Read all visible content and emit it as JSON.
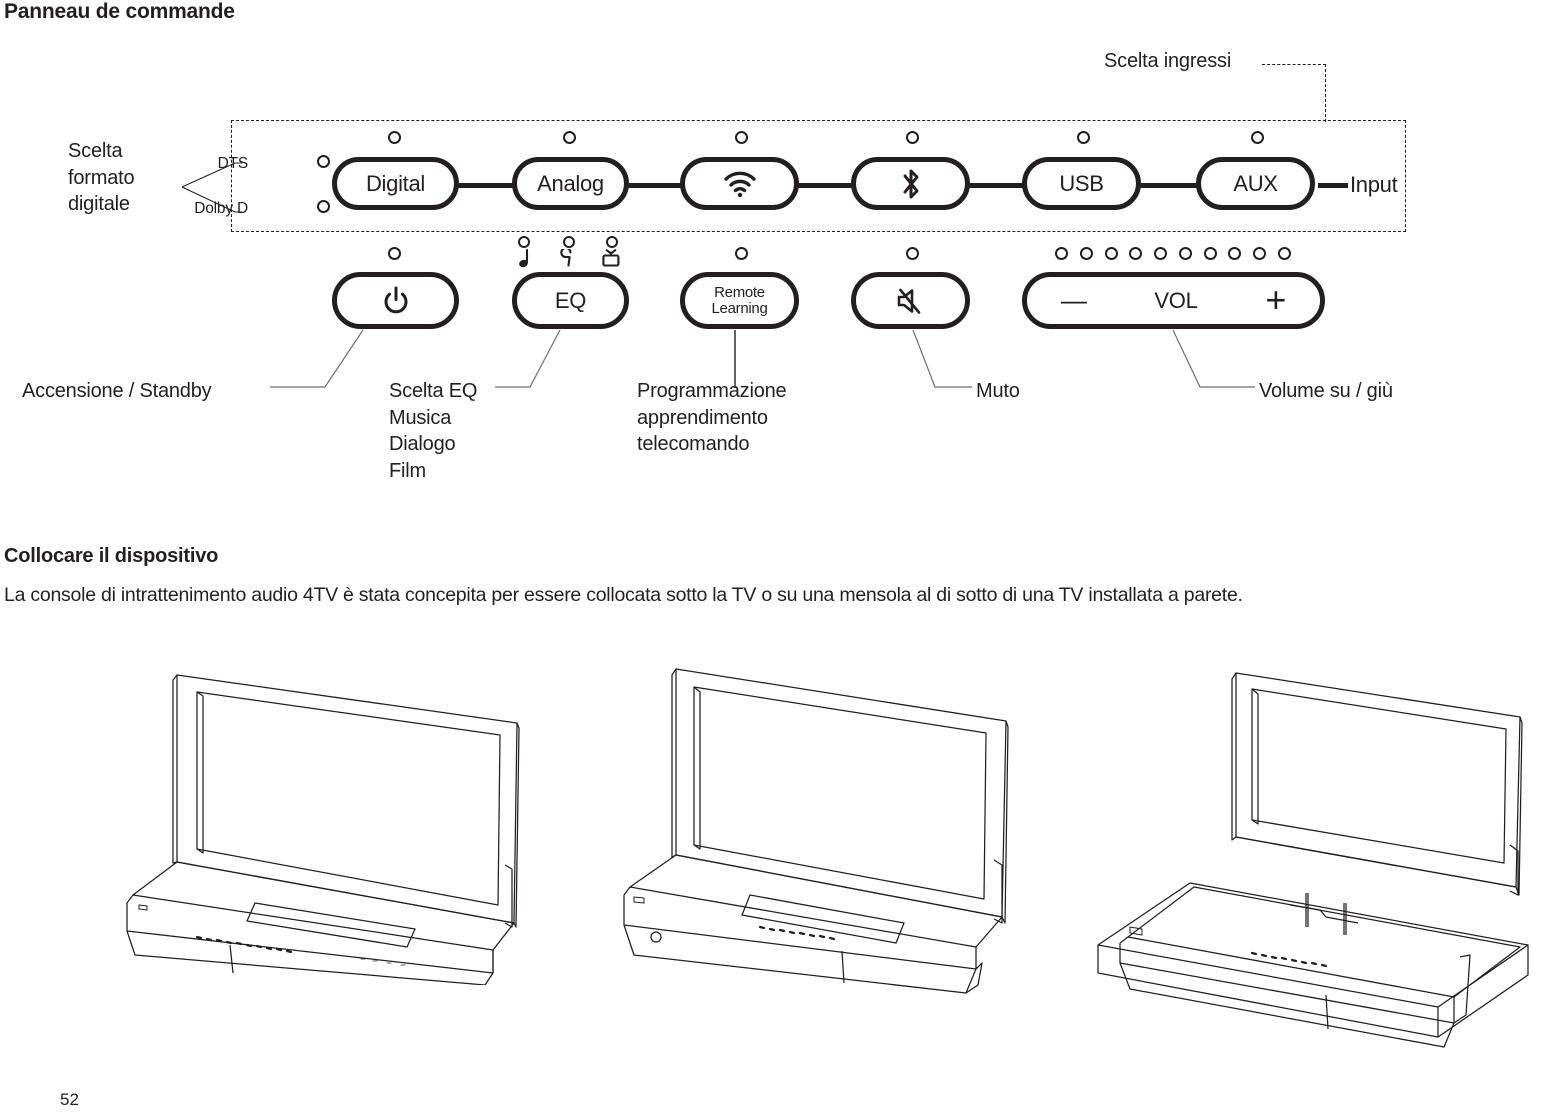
{
  "page": {
    "heading": "Panneau de commande",
    "number": "52"
  },
  "control_panel": {
    "input_group_label": "Scelta ingressi",
    "input_terminal_label": "Input",
    "format_selector": {
      "label": "Scelta\nformato\ndigitale",
      "line1": "Scelta",
      "line2": "formato",
      "line3": "digitale",
      "indicators": [
        {
          "label": "DTS",
          "name": "dts-indicator"
        },
        {
          "label": "Dolby D",
          "name": "dolby-d-indicator"
        }
      ]
    },
    "source_buttons": [
      {
        "label": "Digital",
        "icon": "",
        "name": "digital-button"
      },
      {
        "label": "Analog",
        "icon": "",
        "name": "analog-button"
      },
      {
        "label": "",
        "icon": "wifi-icon",
        "name": "wifi-button"
      },
      {
        "label": "",
        "icon": "bluetooth-icon",
        "name": "bluetooth-button"
      },
      {
        "label": "USB",
        "icon": "",
        "name": "usb-button"
      },
      {
        "label": "AUX",
        "icon": "",
        "name": "aux-button"
      }
    ],
    "function_buttons": [
      {
        "label": "",
        "icon": "power-icon",
        "name": "power-button"
      },
      {
        "label": "EQ",
        "icon": "",
        "name": "eq-button"
      },
      {
        "label": "Remote Learning",
        "label_line1": "Remote",
        "label_line2": "Learning",
        "icon": "",
        "name": "remote-learning-button"
      },
      {
        "label": "",
        "icon": "mute-icon",
        "name": "mute-button"
      },
      {
        "label": "VOL",
        "icon": "",
        "name": "volume-button",
        "minus": "—",
        "plus": "+"
      }
    ],
    "eq_mode_icons": [
      {
        "name": "music-note-icon",
        "meaning": "Musica"
      },
      {
        "name": "dialogue-icon",
        "meaning": "Dialogo"
      },
      {
        "name": "tv-film-icon",
        "meaning": "Film"
      }
    ],
    "volume_led_count": 10
  },
  "callouts": [
    {
      "name": "callout-power",
      "lines": [
        "Accensione / Standby"
      ]
    },
    {
      "name": "callout-eq",
      "lines": [
        "Scelta EQ",
        "Musica",
        "Dialogo",
        "Film"
      ]
    },
    {
      "name": "callout-remote-learning",
      "lines": [
        "Programmazione",
        "apprendimento",
        "telecomando"
      ]
    },
    {
      "name": "callout-mute",
      "lines": [
        "Muto"
      ]
    },
    {
      "name": "callout-volume",
      "lines": [
        "Volume su / giù"
      ]
    }
  ],
  "placement_section": {
    "heading": "Collocare il dispositivo",
    "paragraph": "La console di intrattenimento audio 4TV è stata concepita per essere collocata sotto la TV o su una mensola al di sotto di una TV installata a parete.",
    "illustrations": [
      {
        "name": "tv-on-console-front-illustration"
      },
      {
        "name": "tv-on-console-angled-illustration"
      },
      {
        "name": "tv-wall-mounted-shelf-illustration"
      }
    ]
  },
  "colors": {
    "ink": "#231f20",
    "leader": "#6d6e71",
    "background": "#ffffff"
  }
}
